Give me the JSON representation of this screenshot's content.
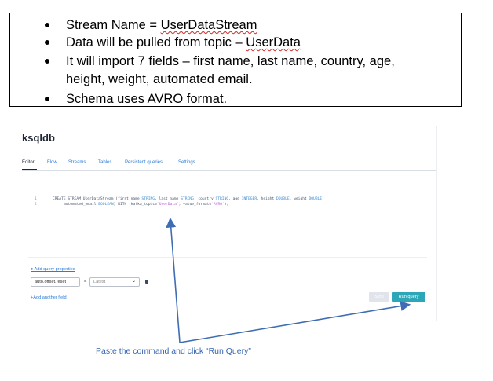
{
  "bullets": [
    {
      "prefix": "Stream Name = ",
      "underlined": "UserDataStream",
      "suffix": ""
    },
    {
      "prefix": "Data will be pulled from topic – ",
      "underlined": "UserData",
      "suffix": ""
    },
    {
      "line1": "It will import 7 fields – first name, last name, country, age,",
      "line2": "height, weight, automated email."
    },
    {
      "prefix": "Schema uses AVRO format.",
      "underlined": "",
      "suffix": ""
    }
  ],
  "app": {
    "title": "ksqldb",
    "tabs": [
      "Editor",
      "Flow",
      "Streams",
      "Tables",
      "Persistent queries",
      "Settings"
    ],
    "active_tab": "Editor"
  },
  "editor": {
    "line_numbers": [
      "1",
      "2"
    ],
    "line1": {
      "a": "CREATE STREAM UserDataStream (first_name ",
      "t1": "STRING",
      "b": ", last_name ",
      "t2": "STRING",
      "c": ", country ",
      "t3": "STRING",
      "d": ", age ",
      "t4": "INTEGER",
      "e": ", height ",
      "t5": "DOUBLE",
      "f": ", weight ",
      "t6": "DOUBLE",
      "g": ","
    },
    "line2": {
      "a": "automated_email ",
      "t1": "BOOLEAN",
      "b": ") WITH (kafka_topic=",
      "s1": "'UserData'",
      "c": ", value_format=",
      "s2": "'AVRO'",
      "d": ");"
    }
  },
  "properties": {
    "add_link": "● Add query properties",
    "key_value": "auto.offset.reset",
    "equals": "=",
    "selected_option": "Latest",
    "add_field": "+Add another field"
  },
  "buttons": {
    "stop": "Stop",
    "run": "Run query"
  },
  "annotation": {
    "caption": "Paste the command and click “Run Query”",
    "arrow_color": "#3f6db3"
  }
}
